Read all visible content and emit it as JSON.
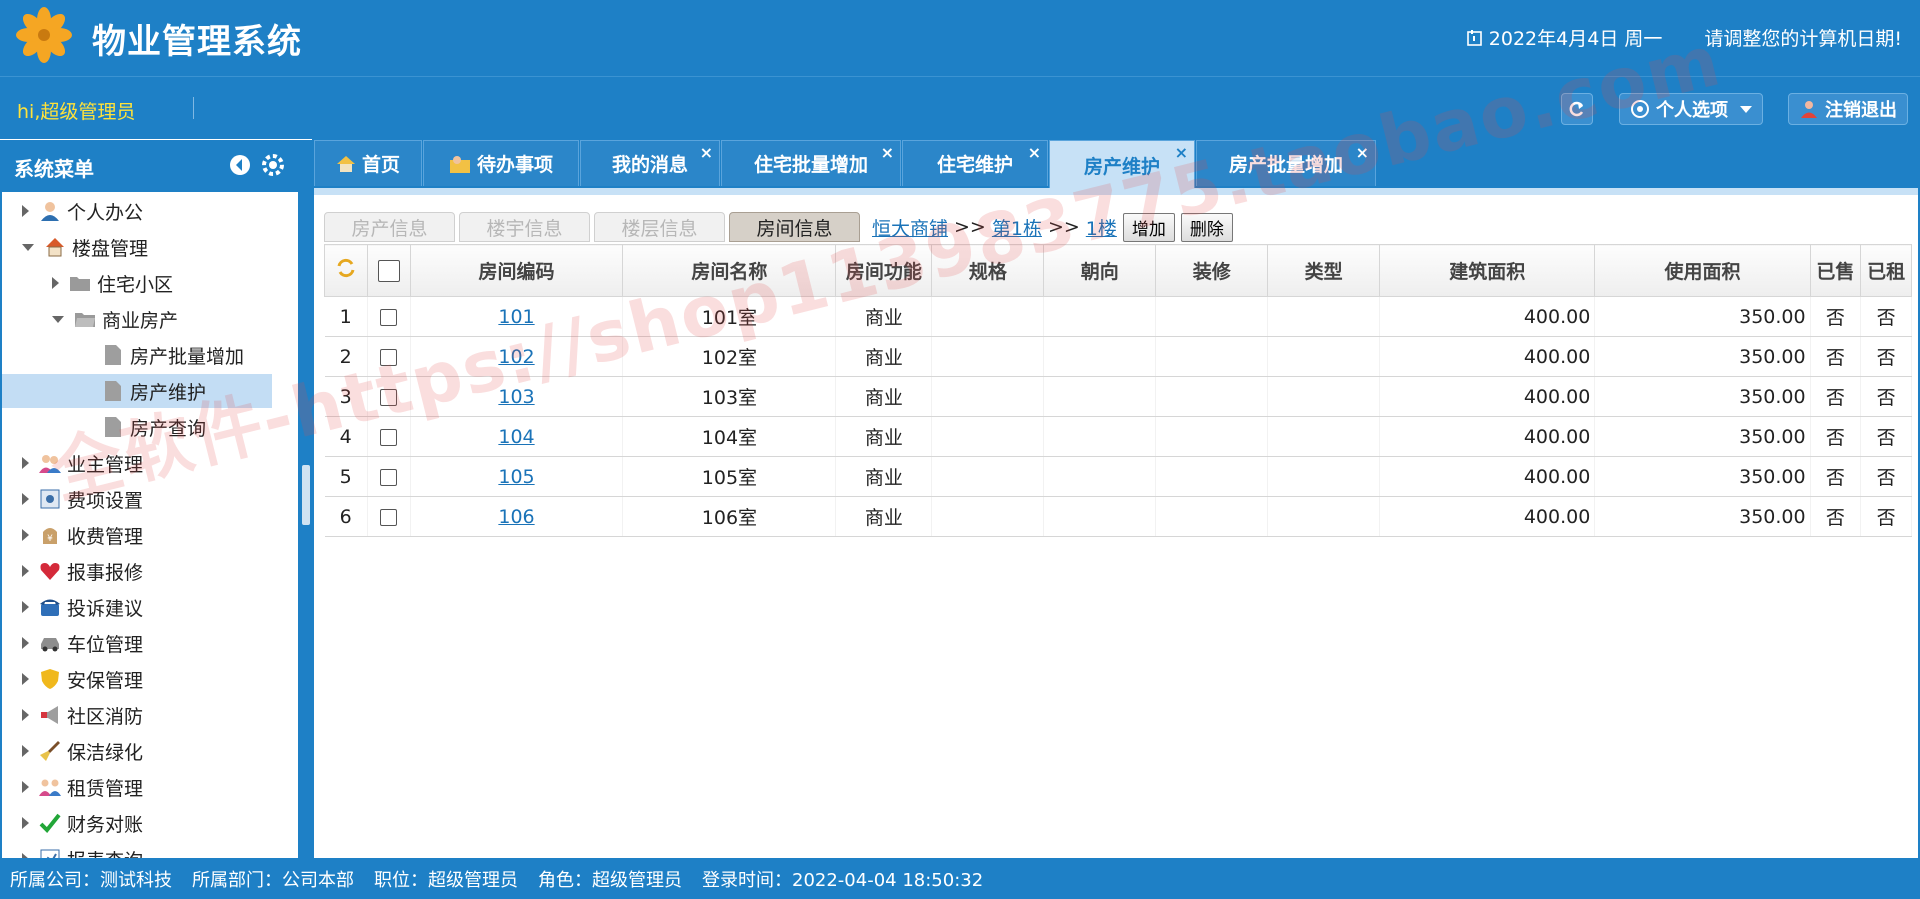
{
  "app": {
    "title": "物业管理系统",
    "date": "2022年4月4日 周一",
    "date_hint": "请调整您的计算机日期!"
  },
  "userbar": {
    "greeting": "hi,超级管理员",
    "personal_options": "个人选项",
    "logout": "注销退出"
  },
  "sidebar": {
    "title": "系统菜单",
    "items": [
      {
        "label": "个人办公",
        "icon": "user-icon"
      },
      {
        "label": "楼盘管理",
        "icon": "home-icon"
      },
      {
        "label": "住宅小区",
        "icon": "folder-icon"
      },
      {
        "label": "商业房产",
        "icon": "folder-open-icon"
      },
      {
        "label": "房产批量增加",
        "icon": "page-icon"
      },
      {
        "label": "房产维护",
        "icon": "page-icon"
      },
      {
        "label": "房产查询",
        "icon": "page-icon"
      },
      {
        "label": "业主管理",
        "icon": "people-icon"
      },
      {
        "label": "费项设置",
        "icon": "settings-icon"
      },
      {
        "label": "收费管理",
        "icon": "money-icon"
      },
      {
        "label": "报事报修",
        "icon": "heart-icon"
      },
      {
        "label": "投诉建议",
        "icon": "phone-icon"
      },
      {
        "label": "车位管理",
        "icon": "car-icon"
      },
      {
        "label": "安保管理",
        "icon": "shield-icon"
      },
      {
        "label": "社区消防",
        "icon": "megaphone-icon"
      },
      {
        "label": "保洁绿化",
        "icon": "broom-icon"
      },
      {
        "label": "租赁管理",
        "icon": "group-icon"
      },
      {
        "label": "财务对账",
        "icon": "check-icon"
      },
      {
        "label": "报表查询",
        "icon": "report-icon"
      }
    ]
  },
  "tabs": [
    {
      "label": "首页",
      "icon": "home-icon",
      "closable": false
    },
    {
      "label": "待办事项",
      "icon": "todo-icon",
      "closable": false
    },
    {
      "label": "我的消息",
      "closable": true
    },
    {
      "label": "住宅批量增加",
      "closable": true
    },
    {
      "label": "住宅维护",
      "closable": true
    },
    {
      "label": "房产维护",
      "closable": true,
      "active": true
    },
    {
      "label": "房产批量增加",
      "closable": true
    }
  ],
  "subtabs": [
    "房产信息",
    "楼宇信息",
    "楼层信息",
    "房间信息"
  ],
  "breadcrumb": {
    "a1": "恒大商铺",
    "sep": ">>",
    "a2": "第1栋",
    "a3": "1楼",
    "add": "增加",
    "delete": "删除"
  },
  "grid": {
    "headers": [
      "房间编码",
      "房间名称",
      "房间功能",
      "规格",
      "朝向",
      "装修",
      "类型",
      "建筑面积",
      "使用面积",
      "已售",
      "已租"
    ],
    "rows": [
      {
        "no": "1",
        "code": "101",
        "name": "101室",
        "func": "商业",
        "spec": "",
        "dir": "",
        "deco": "",
        "type": "",
        "area": "400.00",
        "use": "350.00",
        "sold": "否",
        "rent": "否"
      },
      {
        "no": "2",
        "code": "102",
        "name": "102室",
        "func": "商业",
        "spec": "",
        "dir": "",
        "deco": "",
        "type": "",
        "area": "400.00",
        "use": "350.00",
        "sold": "否",
        "rent": "否"
      },
      {
        "no": "3",
        "code": "103",
        "name": "103室",
        "func": "商业",
        "spec": "",
        "dir": "",
        "deco": "",
        "type": "",
        "area": "400.00",
        "use": "350.00",
        "sold": "否",
        "rent": "否"
      },
      {
        "no": "4",
        "code": "104",
        "name": "104室",
        "func": "商业",
        "spec": "",
        "dir": "",
        "deco": "",
        "type": "",
        "area": "400.00",
        "use": "350.00",
        "sold": "否",
        "rent": "否"
      },
      {
        "no": "5",
        "code": "105",
        "name": "105室",
        "func": "商业",
        "spec": "",
        "dir": "",
        "deco": "",
        "type": "",
        "area": "400.00",
        "use": "350.00",
        "sold": "否",
        "rent": "否"
      },
      {
        "no": "6",
        "code": "106",
        "name": "106室",
        "func": "商业",
        "spec": "",
        "dir": "",
        "deco": "",
        "type": "",
        "area": "400.00",
        "use": "350.00",
        "sold": "否",
        "rent": "否"
      }
    ]
  },
  "status": {
    "company": "所属公司：测试科技",
    "dept": "所属部门：公司本部",
    "position": "职位：超级管理员",
    "role": "角色：超级管理员",
    "login": "登录时间：2022-04-04 18:50:32"
  },
  "watermark": "全软件-https://shop113983775.taobao.com",
  "colors": {
    "primary": "#1e80c6",
    "active_tab": "#c7e1f6",
    "link": "#1a73b8",
    "greeting": "#ffe23a"
  }
}
